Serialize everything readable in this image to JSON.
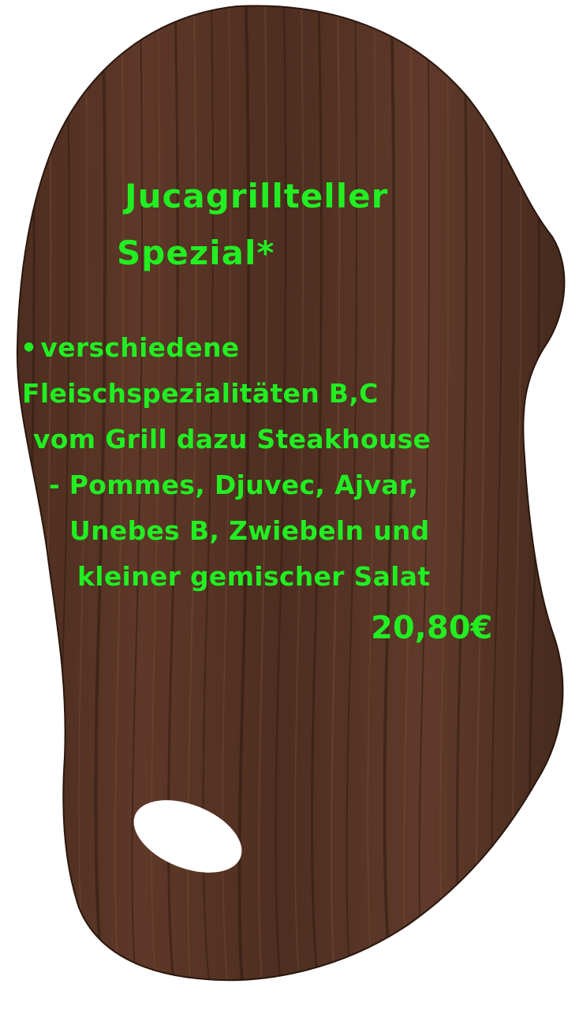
{
  "dish": {
    "title_line1": "Jucagrillteller",
    "title_line2": "Spezial*",
    "bullet": "•",
    "description_lines": [
      "verschiedene",
      "Fleischspezialitäten B,C",
      "vom Grill dazu Steakhouse",
      "- Pommes, Djuvec, Ajvar,",
      "Unebes B, Zwiebeln und",
      "kleiner gemischer Salat"
    ],
    "price": "20,80€"
  },
  "colors": {
    "text": "#22ee22",
    "wood_dark": "#3d2418",
    "wood_mid": "#5a3626",
    "wood_light": "#6e4431",
    "background": "#ffffff"
  },
  "icons": {
    "board": "wooden-cutting-board-icon"
  }
}
